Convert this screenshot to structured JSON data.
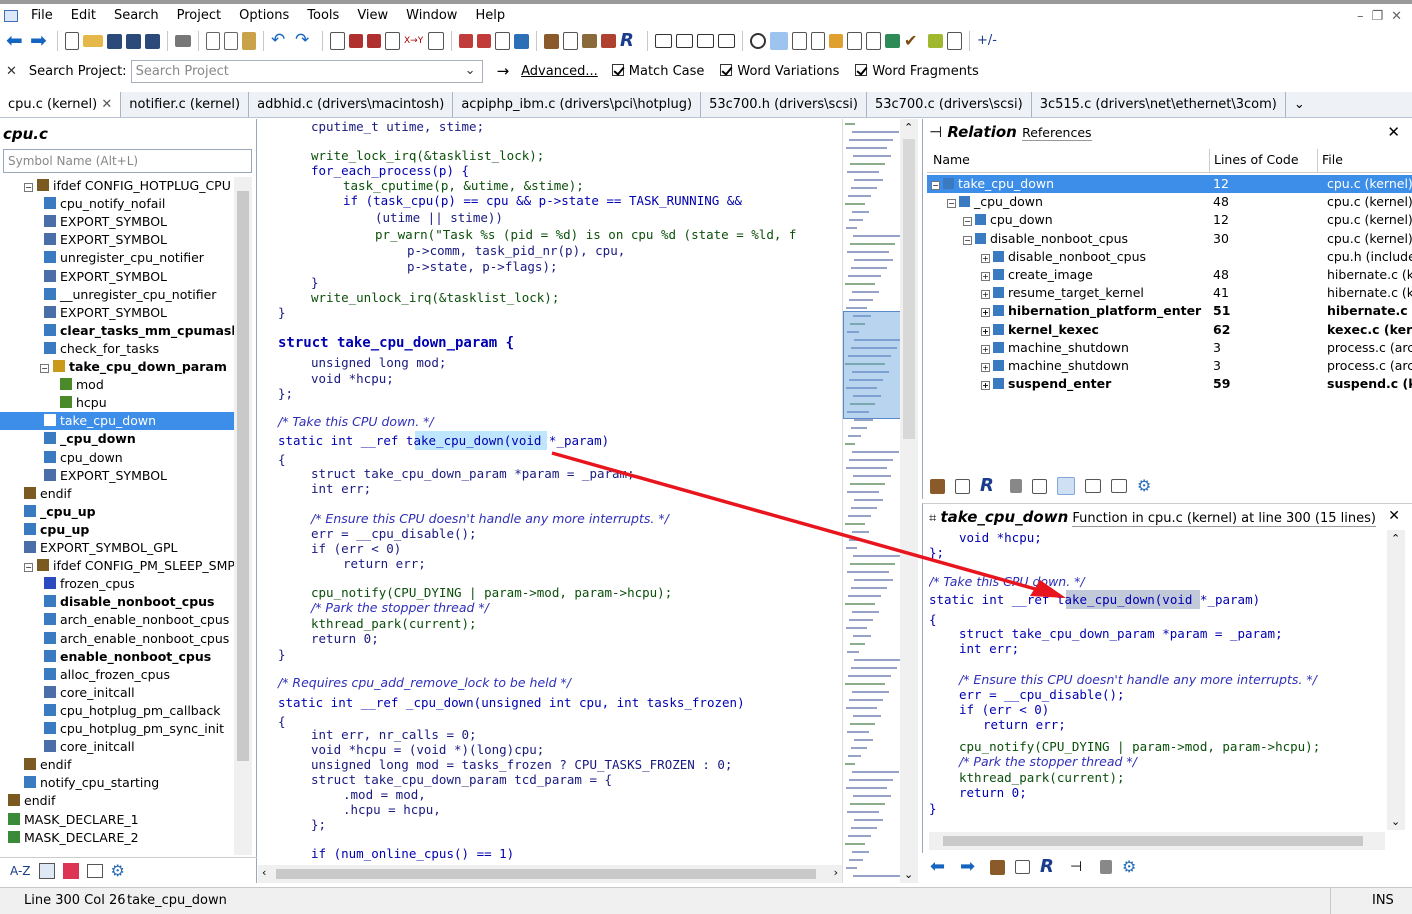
{
  "menu": [
    "File",
    "Edit",
    "Search",
    "Project",
    "Options",
    "Tools",
    "View",
    "Window",
    "Help"
  ],
  "search": {
    "label": "Search Project:",
    "placeholder": "Search Project",
    "advanced": "Advanced...",
    "match_case": "Match Case",
    "word_variations": "Word Variations",
    "word_fragments": "Word Fragments"
  },
  "tabs": [
    "cpu.c (kernel)",
    "notifier.c (kernel)",
    "adbhid.c (drivers\\macintosh)",
    "acpiphp_ibm.c (drivers\\pci\\hotplug)",
    "53c700.h (drivers\\scsi)",
    "53c700.c (drivers\\scsi)",
    "3c515.c (drivers\\net\\ethernet\\3com)"
  ],
  "symbols": {
    "title": "cpu.c",
    "search_placeholder": "Symbol Name (Alt+L)",
    "items": [
      "ifdef CONFIG_HOTPLUG_CPU",
      "cpu_notify_nofail",
      "EXPORT_SYMBOL",
      "EXPORT_SYMBOL",
      "unregister_cpu_notifier",
      "EXPORT_SYMBOL",
      "__unregister_cpu_notifier",
      "EXPORT_SYMBOL",
      "clear_tasks_mm_cpumask",
      "check_for_tasks",
      "take_cpu_down_param",
      "mod",
      "hcpu",
      "take_cpu_down",
      "_cpu_down",
      "cpu_down",
      "EXPORT_SYMBOL",
      "endif",
      "_cpu_up",
      "cpu_up",
      "EXPORT_SYMBOL_GPL",
      "ifdef CONFIG_PM_SLEEP_SMP",
      "frozen_cpus",
      "disable_nonboot_cpus",
      "arch_enable_nonboot_cpus",
      "arch_enable_nonboot_cpus",
      "enable_nonboot_cpus",
      "alloc_frozen_cpus",
      "core_initcall",
      "cpu_hotplug_pm_callback",
      "cpu_hotplug_pm_sync_init",
      "core_initcall",
      "endif",
      "notify_cpu_starting",
      "endif",
      "MASK_DECLARE_1",
      "MASK_DECLARE_2"
    ]
  },
  "code": [
    "cputime_t utime, stime;",
    "write_lock_irq(&tasklist_lock);",
    "for_each_process(p) {",
    "task_cputime(p, &utime, &stime);",
    "if (task_cpu(p) == cpu && p->state == TASK_RUNNING &&",
    "(utime || stime))",
    "pr_warn(\"Task %s (pid = %d) is on cpu %d (state = %ld, f",
    "p->comm, task_pid_nr(p), cpu,",
    "p->state, p->flags);",
    "}",
    "write_unlock_irq(&tasklist_lock);",
    "}",
    "struct take_cpu_down_param {",
    "unsigned long mod;",
    "void *hcpu;",
    "};",
    "/* Take this CPU down. */",
    "static int __ref take_cpu_down(void *_param)",
    "{",
    "struct take_cpu_down_param *param = _param;",
    "int err;",
    "/* Ensure this CPU doesn't handle any more interrupts. */",
    "err = __cpu_disable();",
    "if (err < 0)",
    "return err;",
    "cpu_notify(CPU_DYING | param->mod, param->hcpu);",
    "/* Park the stopper thread */",
    "kthread_park(current);",
    "return 0;",
    "}",
    "/* Requires cpu_add_remove_lock to be held */",
    "static int __ref _cpu_down(unsigned int cpu, int tasks_frozen)",
    "{",
    "int err, nr_calls = 0;",
    "void *hcpu = (void *)(long)cpu;",
    "unsigned long mod = tasks_frozen ? CPU_TASKS_FROZEN : 0;",
    "struct take_cpu_down_param tcd_param = {",
    ".mod = mod,",
    ".hcpu = hcpu,",
    "};",
    "if (num_online_cpus() == 1)"
  ],
  "relation": {
    "title": "Relation",
    "subtitle": "References",
    "columns": [
      "Name",
      "Lines of Code",
      "File"
    ],
    "rows": [
      {
        "name": "take_cpu_down",
        "loc": "12",
        "file": "cpu.c (kernel)"
      },
      {
        "name": "_cpu_down",
        "loc": "48",
        "file": "cpu.c (kernel)"
      },
      {
        "name": "cpu_down",
        "loc": "12",
        "file": "cpu.c (kernel)"
      },
      {
        "name": "disable_nonboot_cpus",
        "loc": "30",
        "file": "cpu.c (kernel)"
      },
      {
        "name": "disable_nonboot_cpus",
        "loc": "",
        "file": "cpu.h (include"
      },
      {
        "name": "create_image",
        "loc": "48",
        "file": "hibernate.c (k"
      },
      {
        "name": "resume_target_kernel",
        "loc": "41",
        "file": "hibernate.c (k"
      },
      {
        "name": "hibernation_platform_enter",
        "loc": "51",
        "file": "hibernate.c (k"
      },
      {
        "name": "kernel_kexec",
        "loc": "62",
        "file": "kexec.c (kern"
      },
      {
        "name": "machine_shutdown",
        "loc": "3",
        "file": "process.c (arc"
      },
      {
        "name": "machine_shutdown",
        "loc": "3",
        "file": "process.c (arc"
      },
      {
        "name": "suspend_enter",
        "loc": "59",
        "file": "suspend.c (ke"
      }
    ]
  },
  "preview": {
    "symbol": "take_cpu_down",
    "desc": "Function in cpu.c (kernel) at line 300 (15 lines)",
    "code": [
      "void *hcpu;",
      "};",
      "/* Take this CPU down. */",
      "static int __ref take_cpu_down(void *_param)",
      "{",
      "struct take_cpu_down_param *param = _param;",
      "int err;",
      "/* Ensure this CPU doesn't handle any more interrupts. */",
      "err = __cpu_disable();",
      "if (err < 0)",
      "return err;",
      "cpu_notify(CPU_DYING | param->mod, param->hcpu);",
      "/* Park the stopper thread */",
      "kthread_park(current);",
      "return 0;",
      "}"
    ]
  },
  "status": {
    "position": "Line 300  Col 26",
    "symbol": "take_cpu_down",
    "mode": "INS"
  },
  "colors": {
    "accent": "#3d8ee8",
    "arrow": "#e8141e",
    "selection_dark": "#0b2d6b"
  }
}
